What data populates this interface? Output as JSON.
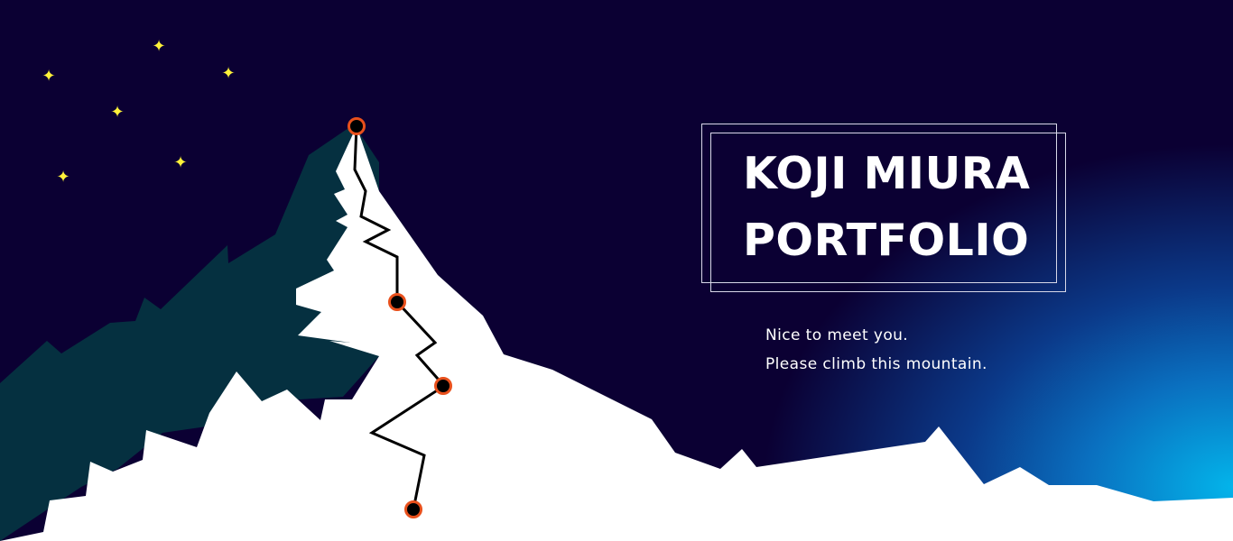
{
  "hero": {
    "title_line1": "KOJI MIURA",
    "title_line2": "PORTFOLIO",
    "greeting_line1": "Nice to meet you.",
    "greeting_line2": "Please climb this mountain."
  },
  "icons": {
    "star": "✦"
  },
  "colors": {
    "sky": "#0b0033",
    "glow": "#03b4ea",
    "mountain_shadow": "#053040",
    "snow": "#ffffff",
    "star": "#fff23a",
    "checkpoint_ring": "#e8501c",
    "checkpoint_fill": "#000000",
    "trail": "#000000"
  }
}
